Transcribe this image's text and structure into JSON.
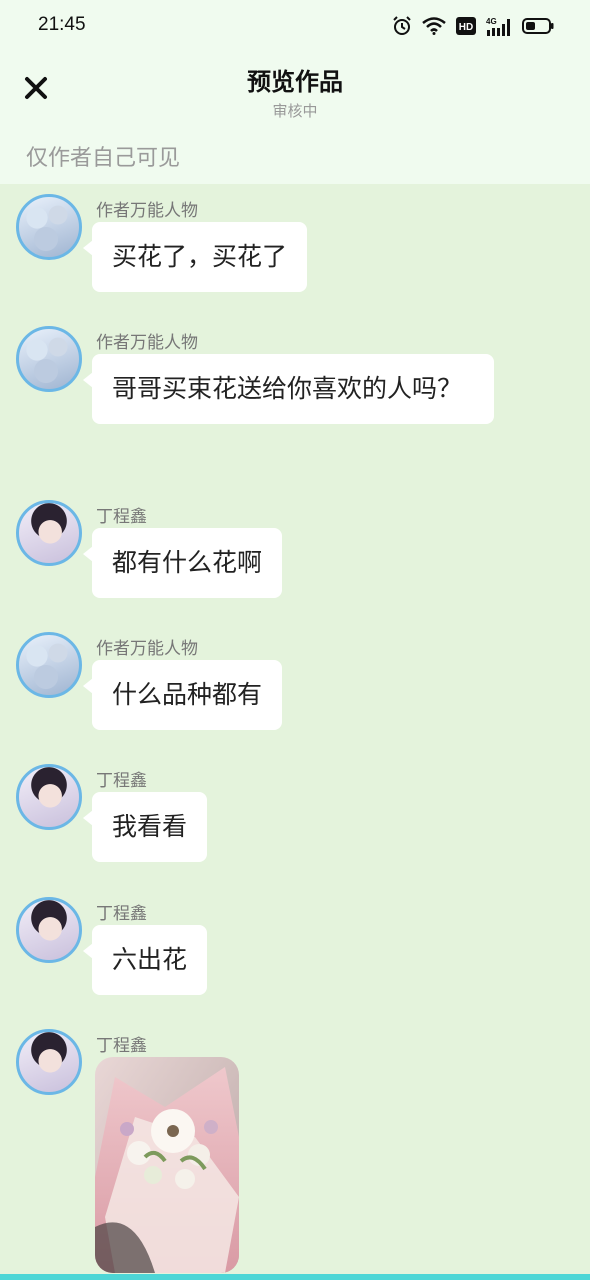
{
  "status_bar": {
    "time": "21:45",
    "hd_label": "HD",
    "network_label": "4G"
  },
  "header": {
    "title": "预览作品",
    "subtitle": "审核中",
    "visibility_note": "仅作者自己可见"
  },
  "messages": [
    {
      "sender": "作者万能人物",
      "text": "买花了，买花了"
    },
    {
      "sender": "作者万能人物",
      "text": "哥哥买束花送给你喜欢的人吗？"
    },
    {
      "sender": "丁程鑫",
      "text": "都有什么花啊"
    },
    {
      "sender": "作者万能人物",
      "text": "什么品种都有"
    },
    {
      "sender": "丁程鑫",
      "text": "我看看"
    },
    {
      "sender": "丁程鑫",
      "text": "六出花"
    },
    {
      "sender": "丁程鑫",
      "image": "bouquet-photo"
    }
  ],
  "colors": {
    "chat_background": "#e4f3dc",
    "header_background": "#f0fbef",
    "avatar_border": "#6bb7e6",
    "bubble": "#ffffff"
  }
}
